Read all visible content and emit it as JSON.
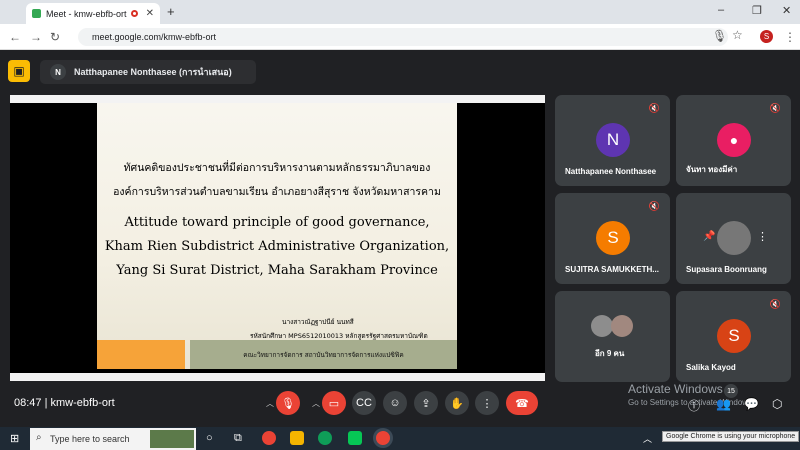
{
  "browser": {
    "tab_title": "Meet - kmw-ebfb-ort",
    "new_tab": "+",
    "url": "meet.google.com/kmw-ebfb-ort",
    "profile_initial": "S",
    "window_controls": [
      "–",
      "❐",
      "✕"
    ]
  },
  "meet": {
    "presenter_initial": "N",
    "presenter_label": "Natthapanee Nonthasee (การนำเสนอ)",
    "meeting_time": "08:47",
    "meeting_code": "kmw-ebfb-ort"
  },
  "slide": {
    "thai_title_1": "ทัศนคติของประชาชนที่มีต่อการบริหารงานตามหลักธรรมาภิบาลของ",
    "thai_title_2": "องค์การบริหารส่วนตำบลขามเรียน อำเภอยางสีสุราช จังหวัดมหาสารคาม",
    "eng_1": "Attitude toward principle of good governance,",
    "eng_2": "Kham Rien Subdistrict Administrative Organization,",
    "eng_3": "Yang Si Surat District, Maha Sarakham Province",
    "author": "นางสาวณัฏฐาปนีย์  นนทสี",
    "student_id": "รหัสนักศึกษา MPS6512010013  หลักสูตรรัฐศาสตรมหาบัณฑิต",
    "faculty": "คณะวิทยาการจัดการ สถาบันวิทยาการจัดการแห่งแปซิฟิค"
  },
  "participants": [
    {
      "name": "Natthapanee Nonthasee",
      "initial": "N",
      "color": "#5e35b1",
      "muted": true
    },
    {
      "name": "จันทา ทองมีค่า",
      "initial": "",
      "color": "#e91e63",
      "muted": true
    },
    {
      "name": "SUJITRA SAMUKKETH...",
      "initial": "S",
      "color": "#f57c00",
      "muted": true
    },
    {
      "name": "Supasara Boonruang",
      "initial": "",
      "color": "#777777",
      "muted": false
    },
    {
      "name": "อีก 9 คน",
      "initial": "",
      "color": "#8d8d8d",
      "muted": false
    },
    {
      "name": "Salika Kayod",
      "initial": "S",
      "color": "#d84315",
      "muted": true
    }
  ],
  "windows": {
    "activate_title": "Activate Windows",
    "activate_sub": "Go to Settings to activate Windows.",
    "badge": "15",
    "search_placeholder": "Type here to search",
    "tooltip": "Google Chrome is using your microphone"
  }
}
